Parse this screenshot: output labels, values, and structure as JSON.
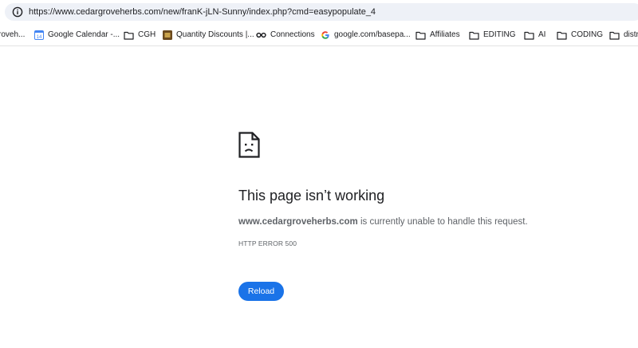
{
  "address_bar": {
    "url": "https://www.cedargroveherbs.com/new/franK-jLN-Sunny/index.php?cmd=easypopulate_4",
    "icon": "info-icon"
  },
  "bookmarks": [
    {
      "label": "roveh...",
      "icon": "none"
    },
    {
      "label": "Google Calendar -...",
      "icon": "calendar-icon"
    },
    {
      "label": "CGH",
      "icon": "folder-icon"
    },
    {
      "label": "Quantity Discounts |...",
      "icon": "site-icon"
    },
    {
      "label": "Connections",
      "icon": "link-icon"
    },
    {
      "label": "google.com/basepa...",
      "icon": "google-icon"
    },
    {
      "label": "Affiliates",
      "icon": "folder-icon"
    },
    {
      "label": "EDITING",
      "icon": "folder-icon"
    },
    {
      "label": "AI",
      "icon": "folder-icon"
    },
    {
      "label": "CODING",
      "icon": "folder-icon"
    },
    {
      "label": "distr",
      "icon": "folder-icon"
    }
  ],
  "error": {
    "icon": "sad-page-icon",
    "title": "This page isn’t working",
    "host": "www.cedargroveherbs.com",
    "description": " is currently unable to handle this request.",
    "code": "HTTP ERROR 500",
    "reload_label": "Reload"
  },
  "colors": {
    "accent": "#1a73e8",
    "omnibox_bg": "#eef1f7",
    "text": "#202124",
    "secondary_text": "#5f6368"
  }
}
